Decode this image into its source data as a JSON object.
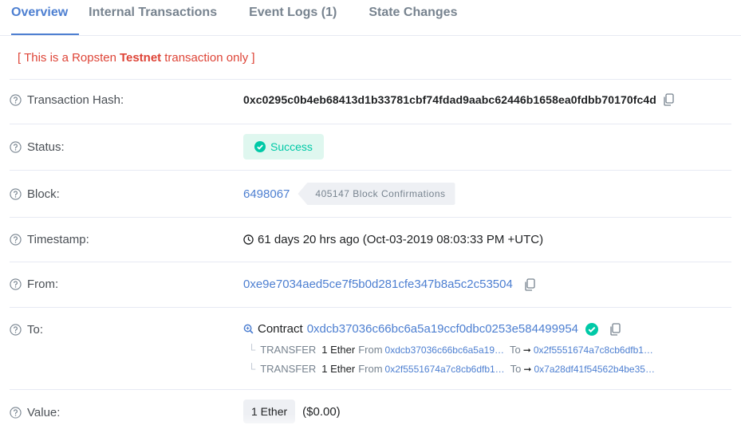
{
  "tabs": [
    {
      "label": "Overview",
      "active": true
    },
    {
      "label": "Internal Transactions",
      "active": false
    },
    {
      "label": "Event Logs (1)",
      "active": false
    },
    {
      "label": "State Changes",
      "active": false
    }
  ],
  "notice": {
    "prefix": "[ This is a Ropsten",
    "bold": "Testnet",
    "suffix": "transaction only ]"
  },
  "tx_hash": {
    "label": "Transaction Hash:",
    "value": "0xc0295c0b4eb68413d1b33781cbf74fdad9aabc62446b1658ea0fdbb70170fc4d"
  },
  "status": {
    "label": "Status:",
    "value": "Success"
  },
  "block": {
    "label": "Block:",
    "number": "6498067",
    "confirmations": "405147 Block Confirmations"
  },
  "timestamp": {
    "label": "Timestamp:",
    "value": "61 days 20 hrs ago (Oct-03-2019 08:03:33 PM +UTC)"
  },
  "from": {
    "label": "From:",
    "address": "0xe9e7034aed5ce7f5b0d281cfe347b8a5c2c53504"
  },
  "to": {
    "label": "To:",
    "contract_label": "Contract",
    "address": "0xdcb37036c66bc6a5a19ccf0dbc0253e584499954",
    "transfers": [
      {
        "type": "TRANSFER",
        "amount": "1 Ether",
        "from_label": "From",
        "from": "0xdcb37036c66bc6a5a19…",
        "to_label": "To",
        "to": "0x2f5551674a7c8cb6dfb1…"
      },
      {
        "type": "TRANSFER",
        "amount": "1 Ether",
        "from_label": "From",
        "from": "0x2f5551674a7c8cb6dfb1…",
        "to_label": "To",
        "to": "0x7a28df41f54562b4be35…"
      }
    ]
  },
  "value": {
    "label": "Value:",
    "amount": "1 Ether",
    "usd": "($0.00)"
  },
  "colors": {
    "accent": "#4d7fd1",
    "success": "#00c9a7",
    "danger": "#de4437"
  }
}
